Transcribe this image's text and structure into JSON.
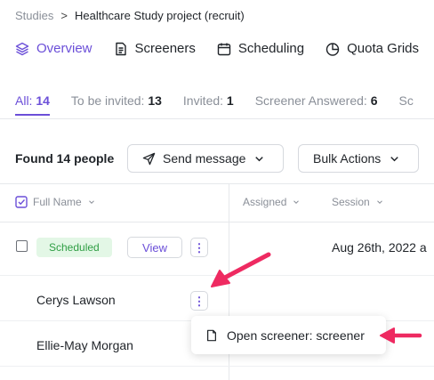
{
  "breadcrumb": {
    "root": "Studies",
    "separator": ">",
    "current": "Healthcare Study project (recruit)"
  },
  "nav": [
    {
      "label": "Overview",
      "icon": "layers-icon",
      "active": true
    },
    {
      "label": "Screeners",
      "icon": "document-icon"
    },
    {
      "label": "Scheduling",
      "icon": "calendar-icon"
    },
    {
      "label": "Quota Grids",
      "icon": "pie-chart-icon"
    }
  ],
  "filters": [
    {
      "label": "All:",
      "count": "14",
      "active": true
    },
    {
      "label": "To be invited:",
      "count": "13"
    },
    {
      "label": "Invited:",
      "count": "1"
    },
    {
      "label": "Screener Answered:",
      "count": "6"
    },
    {
      "label": "Sc"
    }
  ],
  "toolbar": {
    "found": "Found 14 people",
    "send_message": "Send message",
    "bulk_actions": "Bulk Actions"
  },
  "table": {
    "headers": {
      "name": "Full Name",
      "assigned": "Assigned",
      "session": "Session"
    },
    "row1": {
      "status": "Scheduled",
      "view": "View",
      "session": "Aug 26th, 2022 a"
    },
    "row2": {
      "name": "Cerys Lawson"
    },
    "row3": {
      "name": "Ellie-May Morgan"
    }
  },
  "menu": {
    "open_screener": "Open screener: screener"
  },
  "colors": {
    "accent": "#6b4fd8",
    "annotation": "#ee2a61",
    "badge_bg": "#e3f7e6",
    "badge_text": "#2f9e44"
  }
}
